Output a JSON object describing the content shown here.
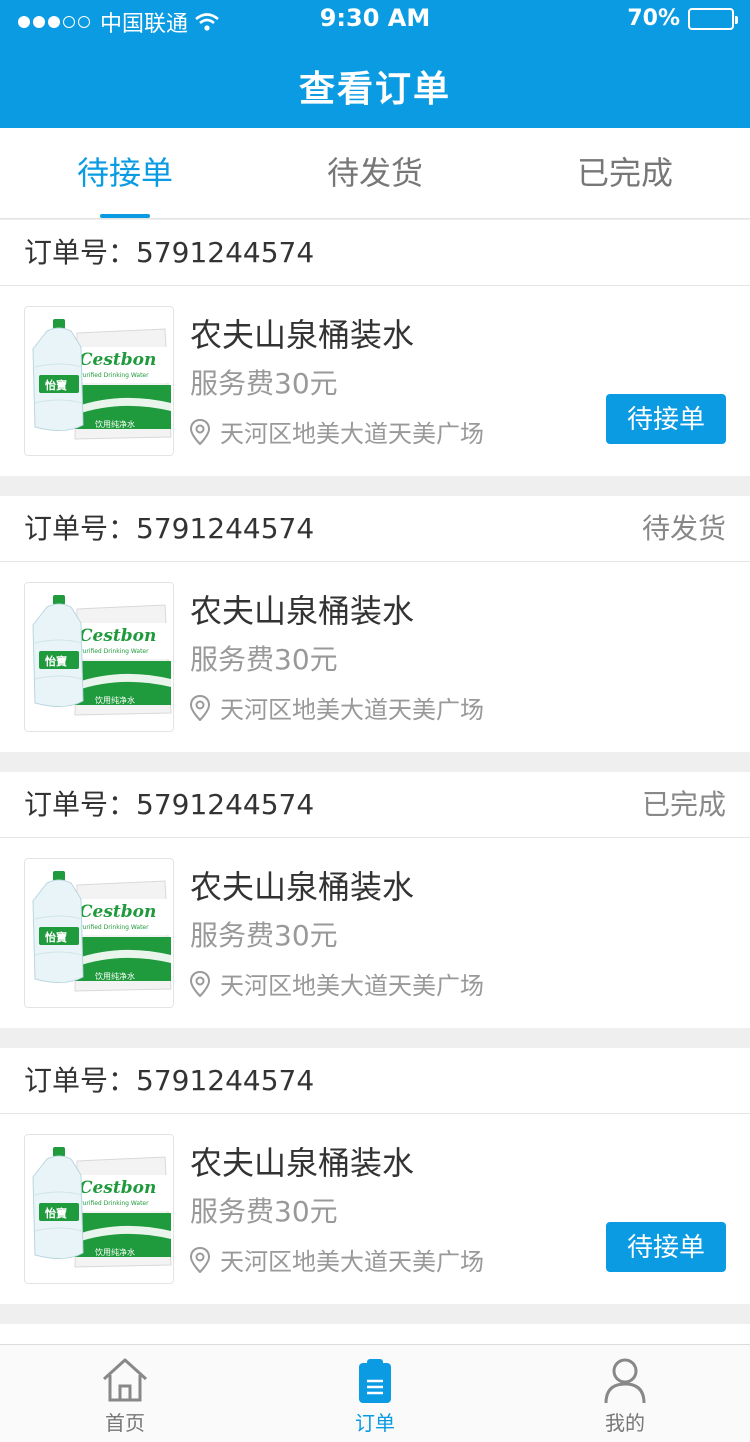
{
  "status_bar": {
    "carrier": "中国联通",
    "time": "9:30 AM",
    "battery": "70%",
    "battery_level": 0.7,
    "signal_bars_filled": 3,
    "signal_bars_total": 5
  },
  "header": {
    "title": "查看订单"
  },
  "tabs": [
    {
      "label": "待接单",
      "active": true
    },
    {
      "label": "待发货",
      "active": false
    },
    {
      "label": "已完成",
      "active": false
    }
  ],
  "orders": [
    {
      "order_label": "订单号：5791244574",
      "state": "",
      "product_name": "农夫山泉桶装水",
      "fee": "服务费30元",
      "address": "天河区地美大道天美广场",
      "action": "待接单"
    },
    {
      "order_label": "订单号：5791244574",
      "state": "待发货",
      "product_name": "农夫山泉桶装水",
      "fee": "服务费30元",
      "address": "天河区地美大道天美广场",
      "action": ""
    },
    {
      "order_label": "订单号：5791244574",
      "state": "已完成",
      "product_name": "农夫山泉桶装水",
      "fee": "服务费30元",
      "address": "天河区地美大道天美广场",
      "action": ""
    },
    {
      "order_label": "订单号：5791244574",
      "state": "",
      "product_name": "农夫山泉桶装水",
      "fee": "服务费30元",
      "address": "天河区地美大道天美广场",
      "action": "待接单"
    }
  ],
  "product_image": {
    "brand": "Cestbon",
    "subtitle": "Purified Drinking Water",
    "cn_brand": "怡寶",
    "cn_sub": "饮用纯净水"
  },
  "bottom_nav": [
    {
      "label": "首页",
      "icon": "home-icon",
      "active": false
    },
    {
      "label": "订单",
      "icon": "order-clipboard-icon",
      "active": true
    },
    {
      "label": "我的",
      "icon": "user-icon",
      "active": false
    }
  ],
  "colors": {
    "primary": "#0b9be2",
    "battery_green": "#4cd964",
    "product_green": "#1f9a3c"
  }
}
